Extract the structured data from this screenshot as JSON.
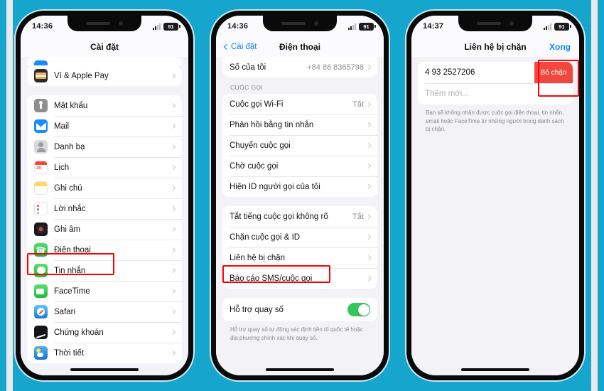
{
  "background_color": "#16a5cd",
  "accent_blue": "#0a84ff",
  "annotation_color": "#ff0000",
  "toggle_on_color": "#34c759",
  "destructive_color": "#f0483e",
  "phones": [
    {
      "name": "settings-screen",
      "status": {
        "time": "14:36",
        "battery": "91"
      },
      "nav": {
        "title": "Cài đặt",
        "back": null,
        "right": null
      },
      "groups": [
        {
          "rows": [
            {
              "icon": "wallet-icon",
              "label": "Ví & Apple Pay",
              "value": null,
              "chevron": true
            }
          ]
        },
        {
          "rows": [
            {
              "icon": "passwords-icon",
              "label": "Mật khẩu",
              "value": null,
              "chevron": true
            },
            {
              "icon": "mail-icon",
              "label": "Mail",
              "value": null,
              "chevron": true
            },
            {
              "icon": "contacts-icon",
              "label": "Danh bạ",
              "value": null,
              "chevron": true
            },
            {
              "icon": "calendar-icon",
              "label": "Lịch",
              "value": null,
              "chevron": true
            },
            {
              "icon": "notes-icon",
              "label": "Ghi chú",
              "value": null,
              "chevron": true
            },
            {
              "icon": "reminders-icon",
              "label": "Lời nhắc",
              "value": null,
              "chevron": true
            },
            {
              "icon": "voice-memos-icon",
              "label": "Ghi âm",
              "value": null,
              "chevron": true
            },
            {
              "icon": "phone-icon",
              "label": "Điện thoại",
              "value": null,
              "chevron": true,
              "highlighted": true
            },
            {
              "icon": "messages-icon",
              "label": "Tin nhắn",
              "value": null,
              "chevron": true
            },
            {
              "icon": "facetime-icon",
              "label": "FaceTime",
              "value": null,
              "chevron": true
            },
            {
              "icon": "safari-icon",
              "label": "Safari",
              "value": null,
              "chevron": true
            },
            {
              "icon": "stocks-icon",
              "label": "Chứng khoán",
              "value": null,
              "chevron": true
            },
            {
              "icon": "weather-icon",
              "label": "Thời tiết",
              "value": null,
              "chevron": true
            }
          ]
        }
      ]
    },
    {
      "name": "phone-settings-screen",
      "status": {
        "time": "14:36",
        "battery": "91"
      },
      "nav": {
        "title": "Điện thoại",
        "back": "Cài đặt",
        "right": null
      },
      "my_number_row": {
        "label": "Số của tôi",
        "value": "+84 86 8365798"
      },
      "section_header": "CUỘC GỌI",
      "call_rows": [
        {
          "label": "Cuộc gọi Wi-Fi",
          "value": "Tắt"
        },
        {
          "label": "Phản hồi bằng tin nhắn",
          "value": null
        },
        {
          "label": "Chuyển cuộc gọi",
          "value": null
        },
        {
          "label": "Chờ cuộc gọi",
          "value": null
        },
        {
          "label": "Hiện ID người gọi của tôi",
          "value": null
        }
      ],
      "block_rows": [
        {
          "label": "Tắt tiếng cuộc gọi không rõ",
          "value": "Tắt"
        },
        {
          "label": "Chặn cuộc gọi & ID",
          "value": null
        },
        {
          "label": "Liên hệ bị chặn",
          "value": null,
          "highlighted": true
        },
        {
          "label": "Báo cáo SMS/cuộc gọi",
          "value": null
        }
      ],
      "dial_assist": {
        "label": "Hỗ trợ quay số",
        "toggle": true
      },
      "dial_assist_note": "Hỗ trợ quay số tự động xác định tiền tố quốc tế hoặc địa phương chính xác khi quay số."
    },
    {
      "name": "blocked-contacts-screen",
      "status": {
        "time": "14:37",
        "battery": "91"
      },
      "nav": {
        "title": "Liên hệ bị chặn",
        "back": null,
        "right": "Xong"
      },
      "blocked": [
        {
          "number": "4 93 2527206",
          "action_label": "Bỏ chặn",
          "highlighted": true
        }
      ],
      "add_new_placeholder": "Thêm mới...",
      "note": "Bạn sẽ không nhận được cuộc gọi điện thoại, tin nhắn, email hoặc FaceTime từ những người trong danh sách bị chặn."
    }
  ]
}
